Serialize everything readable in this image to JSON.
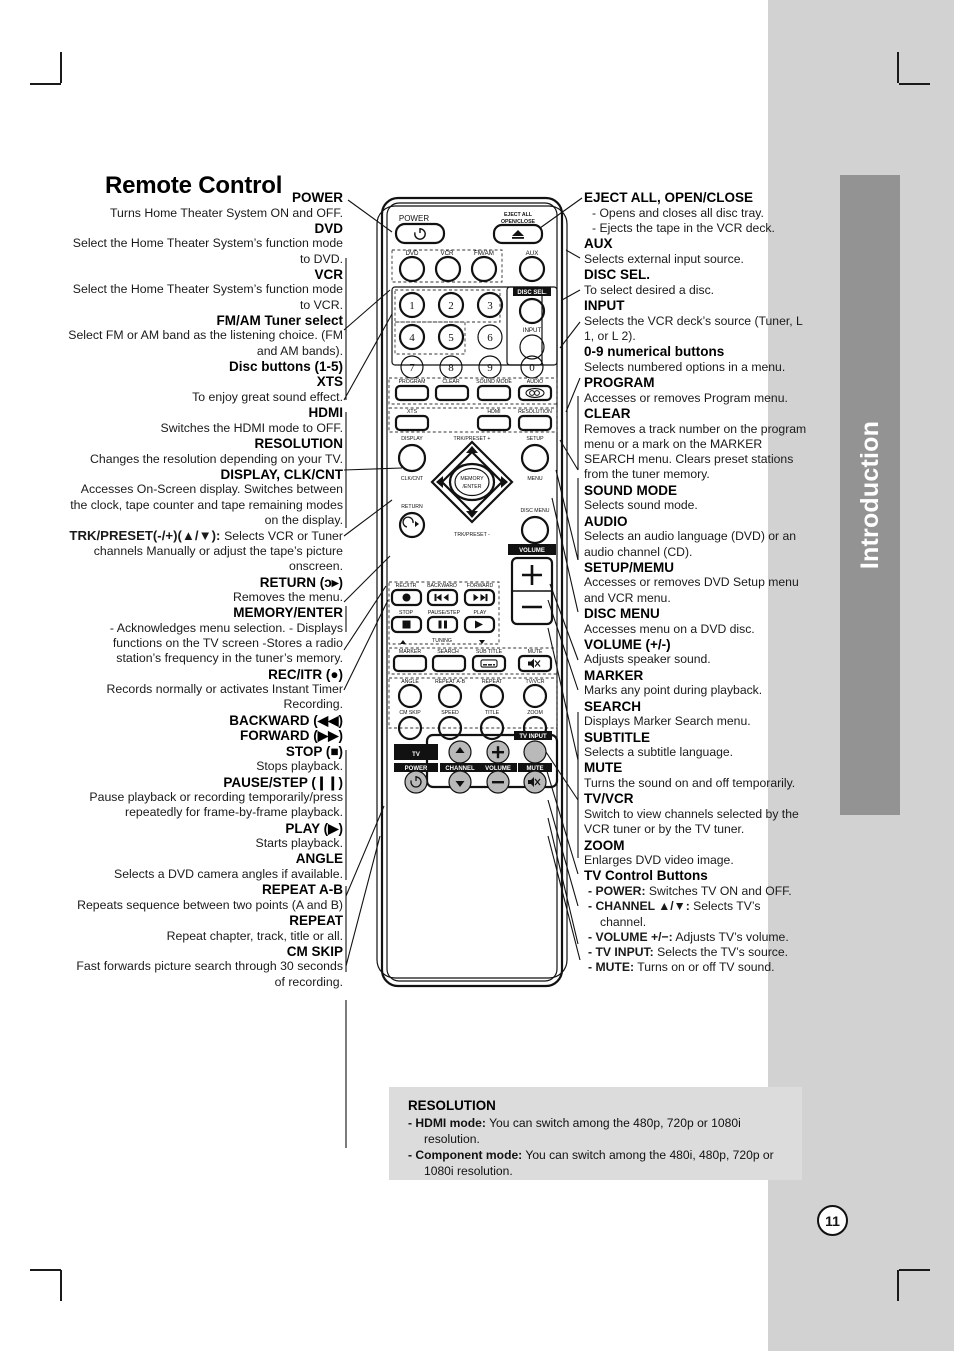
{
  "page": {
    "title": "Remote Control",
    "side_tab_label": "Introduction",
    "page_number": "11",
    "accent_gray": "#d2d2d2",
    "tab_gray": "#939393",
    "note_gray": "#dcdcdc"
  },
  "left_column": [
    {
      "heading": "POWER",
      "body": "Turns Home Theater System ON and OFF."
    },
    {
      "heading": "DVD",
      "body": "Select the Home Theater System’s function mode to DVD."
    },
    {
      "heading": "VCR",
      "body": "Select the Home Theater System’s function mode to VCR."
    },
    {
      "heading": "FM/AM Tuner select",
      "body": "Select FM or AM band as the listening choice. (FM and AM bands)."
    },
    {
      "heading": "Disc buttons (1-5)",
      "body": ""
    },
    {
      "heading": "XTS",
      "body": "To enjoy great sound effect."
    },
    {
      "heading": "HDMI",
      "body": "Switches the HDMI mode to OFF."
    },
    {
      "heading": "RESOLUTION",
      "body": "Changes the resolution depending on your TV."
    },
    {
      "heading": "DISPLAY, CLK/CNT",
      "body": "Accesses On-Screen display. Switches between the clock, tape counter and tape remaining modes on the display."
    },
    {
      "heading": "TRK/PRESET(-/+)(▲/▼):",
      "body": "Selects VCR or Tuner channels Manually or adjust the tape’s picture onscreen.",
      "inline": true
    },
    {
      "heading": "RETURN (ɔ▸)",
      "body": "Removes the menu."
    },
    {
      "heading": "MEMORY/ENTER",
      "body": "- Acknowledges menu selection. - Displays functions on the TV screen -Stores a radio station’s frequency in the tuner’s memory."
    },
    {
      "heading": "REC/ITR (●)",
      "body": "Records normally or activates Instant Timer Recording."
    },
    {
      "heading": "BACKWARD (◀◀)",
      "body": ""
    },
    {
      "heading": "FORWARD (▶▶)",
      "body": ""
    },
    {
      "heading": "STOP (■)",
      "body": "Stops playback."
    },
    {
      "heading": "PAUSE/STEP (❙❙)",
      "body": "Pause playback or recording temporarily/press repeatedly for frame-by-frame playback."
    },
    {
      "heading": "PLAY (▶)",
      "body": "Starts playback."
    },
    {
      "heading": "ANGLE",
      "body": "Selects a DVD camera angles if available."
    },
    {
      "heading": "REPEAT A-B",
      "body": "Repeats sequence between two points (A and B)"
    },
    {
      "heading": "REPEAT",
      "body": "Repeat chapter, track, title or all."
    },
    {
      "heading": "CM SKIP",
      "body": "Fast forwards picture search through 30 seconds of recording."
    }
  ],
  "right_column": [
    {
      "heading": "EJECT ALL, OPEN/CLOSE",
      "dashes": [
        "- Opens and closes all disc tray.",
        "- Ejects the tape in the VCR deck."
      ]
    },
    {
      "heading": "AUX",
      "body": "Selects external input source."
    },
    {
      "heading": "DISC SEL.",
      "body": "To select desired a disc."
    },
    {
      "heading": "INPUT",
      "body": "Selects the VCR deck’s source (Tuner, L 1, or L 2)."
    },
    {
      "heading": "0-9 numerical buttons",
      "body": "Selects numbered options in a menu."
    },
    {
      "heading": "PROGRAM",
      "body": "Accesses or removes Program menu."
    },
    {
      "heading": "CLEAR",
      "body": "Removes a track number on the program menu or a mark on the MARKER SEARCH menu. Clears preset stations from the tuner memory."
    },
    {
      "heading": "SOUND MODE",
      "body": "Selects sound mode."
    },
    {
      "heading": "AUDIO",
      "body": "Selects an audio language (DVD) or an audio channel (CD)."
    },
    {
      "heading": "SETUP/MEMU",
      "body": "Accesses or removes DVD Setup menu and VCR menu."
    },
    {
      "heading": "DISC MENU",
      "body": "Accesses menu on a DVD disc."
    },
    {
      "heading": "VOLUME (+/-)",
      "body": "Adjusts speaker sound."
    },
    {
      "heading": "MARKER",
      "body": "Marks any point during playback."
    },
    {
      "heading": "SEARCH",
      "body": "Displays Marker Search menu."
    },
    {
      "heading": "SUBTITLE",
      "body": "Selects a subtitle language."
    },
    {
      "heading": "MUTE",
      "body": "Turns the sound on and off temporarily."
    },
    {
      "heading": "TV/VCR",
      "body": "Switch to view channels selected by the VCR tuner or by the TV tuner."
    },
    {
      "heading": "ZOOM",
      "body": "Enlarges DVD video image."
    }
  ],
  "tv_control": {
    "heading": "TV Control Buttons",
    "items": [
      {
        "label": "- POWER:",
        "text": " Switches TV ON and OFF."
      },
      {
        "label": "- CHANNEL ▲/▼:",
        "text": " Selects TV’s channel."
      },
      {
        "label": "- VOLUME +/−:",
        "text": " Adjusts TV’s volume."
      },
      {
        "label": "- TV INPUT:",
        "text": " Selects the TV’s source."
      },
      {
        "label": "- MUTE:",
        "text": " Turns on or off TV sound."
      }
    ]
  },
  "note": {
    "heading": "RESOLUTION",
    "lines": [
      {
        "label": "-  HDMI mode:",
        "text": " You can switch among the 480p, 720p or 1080i resolution."
      },
      {
        "label": "-  Component mode:",
        "text": " You can switch among the 480i, 480p, 720p or 1080i resolution."
      }
    ]
  },
  "remote": {
    "labels": {
      "power": "POWER",
      "eject": "EJECT ALL OPEN/CLOSE",
      "eject_l1": "EJECT ALL",
      "eject_l2": "OPEN/CLOSE",
      "dvd": "DVD",
      "vcr": "VCR",
      "fmam": "FM/AM",
      "aux": "AUX",
      "disc_sel": "DISC SEL.",
      "input": "INPUT",
      "num1": "1",
      "num2": "2",
      "num3": "3",
      "num4": "4",
      "num5": "5",
      "num6": "6",
      "num7": "7",
      "num8": "8",
      "num9": "9",
      "num0": "0",
      "program": "PROGRAM",
      "clear": "CLEAR",
      "sound_mode": "SOUND MODE",
      "audio": "AUDIO",
      "xts": "XTS",
      "hdmi": "HDMI",
      "resolution": "RESOLUTION",
      "display": "DISPLAY",
      "clkcnt": "CLK/CNT",
      "trk_preset_plus": "TRK/PRESET +",
      "trk_preset_minus": "TRK/PRESET -",
      "setup": "SETUP",
      "menu": "MENU",
      "memory_enter_l1": "MEMORY",
      "memory_enter_l2": "/ENTER",
      "return": "RETURN",
      "disc_menu": "DISC MENU",
      "volume": "VOLUME",
      "volume_plus": "+",
      "volume_minus": "−",
      "rec_itr": "REC/ITR",
      "backward": "BACKWARD",
      "forward": "FORWARD",
      "stop": "STOP",
      "pause_step": "PAUSE/STEP",
      "play": "PLAY",
      "tuning": "TUNING",
      "marker": "MARKER",
      "search": "SEARCH",
      "subtitle": "SUB TITLE",
      "mute": "MUTE",
      "angle": "ANGLE",
      "repeat_ab": "REPEAT A-B",
      "repeat": "REPEAT",
      "tv_vcr": "TV/VCR",
      "cm_skip": "CM SKIP",
      "speed": "SPEED",
      "title": "TITLE",
      "zoom": "ZOOM",
      "tv": "TV",
      "tv_input": "TV INPUT",
      "tv_power": "POWER",
      "tv_channel": "CHANNEL",
      "tv_volume": "VOLUME",
      "tv_mute": "MUTE"
    }
  }
}
